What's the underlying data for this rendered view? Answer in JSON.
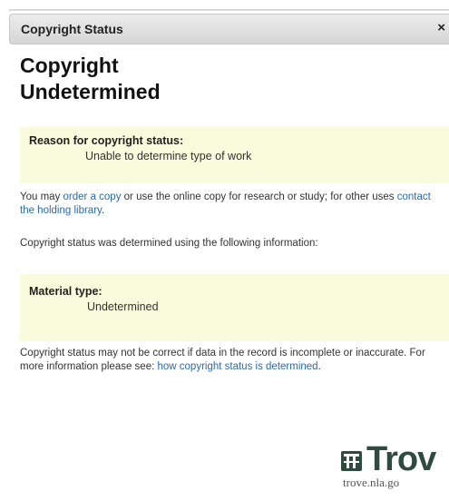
{
  "dialog": {
    "title": "Copyright Status",
    "close_glyph": "×",
    "close_icon": "close-icon"
  },
  "heading": "Copyright Undetermined",
  "reason": {
    "label": "Reason for copyright status:",
    "value": "Unable to determine type of work"
  },
  "usage": {
    "text_before": "You may ",
    "order_link": "order a copy",
    "text_middle": " or use the online copy for research or study; for other uses ",
    "contact_link": "contact the holding library",
    "text_after": "."
  },
  "determined_text": "Copyright status was determined using the following information:",
  "material": {
    "label": "Material type:",
    "value": "Undetermined"
  },
  "disclaimer": {
    "text": "Copyright status may not be correct if data in the record is incomplete or inaccurate. For more information please see: ",
    "link": "how copyright status is determined",
    "text_after": "."
  },
  "logo": {
    "wordmark": "Trov",
    "url": "trove.nla.go",
    "icon": "trove-logo-icon"
  },
  "colors": {
    "note_background": "#fafadc",
    "link": "#2c6aa8",
    "logo": "#2f4b3f"
  }
}
